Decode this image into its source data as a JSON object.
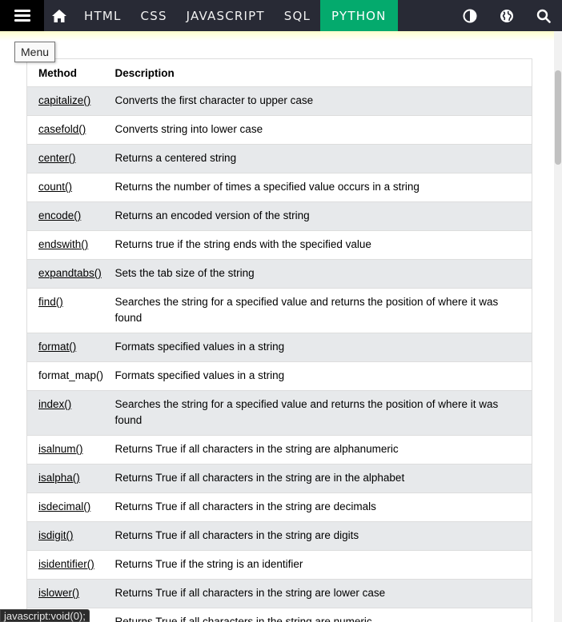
{
  "nav": {
    "menu_icon": "hamburger-menu-icon",
    "home_icon": "home-icon",
    "links": [
      "HTML",
      "CSS",
      "JAVASCRIPT",
      "SQL",
      "PYTHON"
    ],
    "active_link": "PYTHON",
    "contrast_icon": "contrast-icon",
    "globe_icon": "globe-icon",
    "search_icon": "search-icon",
    "active_color": "#04aa6d",
    "bar_color": "#282a35"
  },
  "tooltip": {
    "text": "Menu"
  },
  "table": {
    "headers": {
      "method": "Method",
      "description": "Description"
    },
    "rows": [
      {
        "method": "capitalize()",
        "linked": true,
        "description": "Converts the first character to upper case"
      },
      {
        "method": "casefold()",
        "linked": true,
        "description": "Converts string into lower case"
      },
      {
        "method": "center()",
        "linked": true,
        "description": "Returns a centered string"
      },
      {
        "method": "count()",
        "linked": true,
        "description": "Returns the number of times a specified value occurs in a string"
      },
      {
        "method": "encode()",
        "linked": true,
        "description": "Returns an encoded version of the string"
      },
      {
        "method": "endswith()",
        "linked": true,
        "description": "Returns true if the string ends with the specified value"
      },
      {
        "method": "expandtabs()",
        "linked": true,
        "description": "Sets the tab size of the string"
      },
      {
        "method": "find()",
        "linked": true,
        "description": "Searches the string for a specified value and returns the position of where it was found"
      },
      {
        "method": "format()",
        "linked": true,
        "description": "Formats specified values in a string"
      },
      {
        "method": "format_map()",
        "linked": false,
        "description": "Formats specified values in a string"
      },
      {
        "method": "index()",
        "linked": true,
        "description": "Searches the string for a specified value and returns the position of where it was found"
      },
      {
        "method": "isalnum()",
        "linked": true,
        "description": "Returns True if all characters in the string are alphanumeric"
      },
      {
        "method": "isalpha()",
        "linked": true,
        "description": "Returns True if all characters in the string are in the alphabet"
      },
      {
        "method": "isdecimal()",
        "linked": true,
        "description": "Returns True if all characters in the string are decimals"
      },
      {
        "method": "isdigit()",
        "linked": true,
        "description": "Returns True if all characters in the string are digits"
      },
      {
        "method": "isidentifier()",
        "linked": true,
        "description": "Returns True if the string is an identifier"
      },
      {
        "method": "islower()",
        "linked": true,
        "description": "Returns True if all characters in the string are lower case"
      },
      {
        "method": "",
        "linked": true,
        "description": "Returns True if all characters in the string are numeric"
      }
    ]
  },
  "status_bar": {
    "text": "javascript:void(0);"
  }
}
